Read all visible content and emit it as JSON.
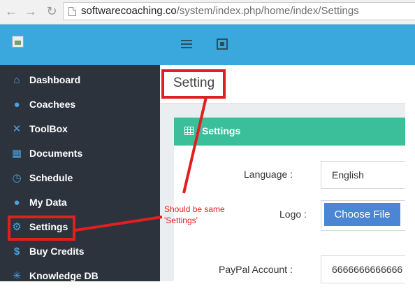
{
  "browser": {
    "url_host": "softwarecoaching.co",
    "url_path": "/system/index.php/home/index/Settings"
  },
  "header": {
    "logo_icon": "broken-image-icon",
    "menu_icon": "hamburger-icon",
    "fullscreen_icon": "fullscreen-icon"
  },
  "sidebar": {
    "items": [
      {
        "label": "Dashboard",
        "icon": "home-icon"
      },
      {
        "label": "Coachees",
        "icon": "user-add-icon"
      },
      {
        "label": "ToolBox",
        "icon": "tools-icon"
      },
      {
        "label": "Documents",
        "icon": "documents-icon"
      },
      {
        "label": "Schedule",
        "icon": "clock-icon"
      },
      {
        "label": "My Data",
        "icon": "user-icon"
      },
      {
        "label": "Settings",
        "icon": "gears-icon"
      },
      {
        "label": "Buy Credits",
        "icon": "dollar-icon"
      },
      {
        "label": "Knowledge DB",
        "icon": "bulb-icon"
      }
    ]
  },
  "main": {
    "page_title": "Setting",
    "panel_title": "Settings",
    "fields": {
      "language_label": "Language :",
      "language_value": "English",
      "logo_label": "Logo :",
      "choose_file": "Choose File",
      "paypal_label": "PayPal Account :",
      "paypal_value": "6666666666666"
    }
  },
  "annotation": {
    "note_line1": "Should be same",
    "note_line2": "'Settings'",
    "color": "#e02020"
  },
  "colors": {
    "header": "#3aa8dc",
    "sidebar": "#2c333d",
    "panel_header": "#3bbf9b",
    "button": "#4a86d4"
  }
}
